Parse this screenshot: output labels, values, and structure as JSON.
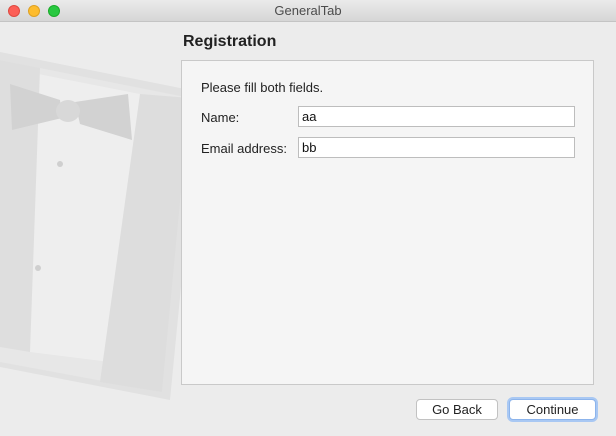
{
  "window": {
    "title": "GeneralTab"
  },
  "page": {
    "title": "Registration"
  },
  "form": {
    "instructions": "Please fill both fields.",
    "name": {
      "label": "Name:",
      "value": "aa"
    },
    "email": {
      "label": "Email address:",
      "value": "bb"
    }
  },
  "buttons": {
    "back": "Go Back",
    "continue": "Continue"
  },
  "icons": {
    "close": "close-icon",
    "minimize": "minimize-icon",
    "zoom": "zoom-icon",
    "watermark": "tuxedo-watermark-icon"
  },
  "colors": {
    "close": "#fc5f57",
    "minimize": "#fdbc2e",
    "zoom": "#28c840",
    "focus_ring": "#a9c8f3"
  }
}
